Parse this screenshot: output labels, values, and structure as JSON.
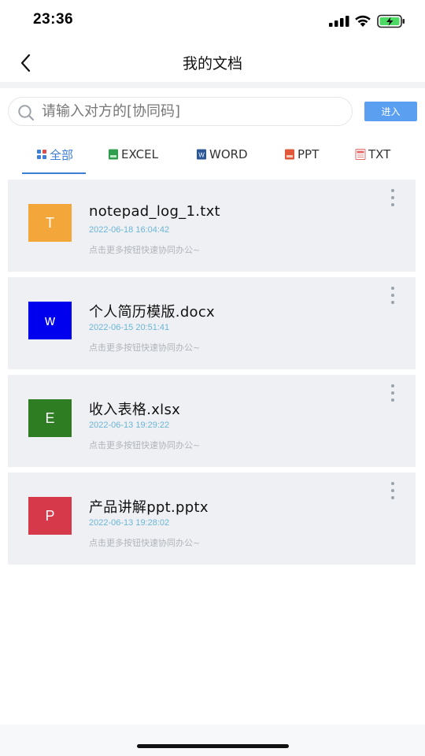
{
  "status_bar": {
    "time": "23:36"
  },
  "nav": {
    "title": "我的文档"
  },
  "search": {
    "placeholder": "请输入对方的[协同码]",
    "value": "",
    "enter_label": "进入"
  },
  "tabs": [
    {
      "label": "全部",
      "icon": "grid-icon",
      "active": true
    },
    {
      "label": "EXCEL",
      "icon": "excel-file-icon",
      "active": false
    },
    {
      "label": "WORD",
      "icon": "word-file-icon",
      "active": false
    },
    {
      "label": "PPT",
      "icon": "ppt-file-icon",
      "active": false
    },
    {
      "label": "TXT",
      "icon": "txt-file-icon",
      "active": false
    }
  ],
  "documents": [
    {
      "letter": "T",
      "color": "#f3a73b",
      "name": "notepad_log_1.txt",
      "date": "2022-06-18 16:04:42",
      "hint": "点击更多按钮快速协同办公~"
    },
    {
      "letter": "w",
      "color": "#0000ee",
      "name": "个人简历模版.docx",
      "date": "2022-06-15 20:51:41",
      "hint": "点击更多按钮快速协同办公~"
    },
    {
      "letter": "E",
      "color": "#2f7d22",
      "name": "收入表格.xlsx",
      "date": "2022-06-13 19:29:22",
      "hint": "点击更多按钮快速协同办公~"
    },
    {
      "letter": "P",
      "color": "#d5394a",
      "name": "产品讲解ppt.pptx",
      "date": "2022-06-13 19:28:02",
      "hint": "点击更多按钮快速协同办公~"
    }
  ],
  "colors": {
    "accent": "#3d7fd6",
    "enter_button": "#5b9ff1",
    "date_text": "#6bb6d6"
  }
}
